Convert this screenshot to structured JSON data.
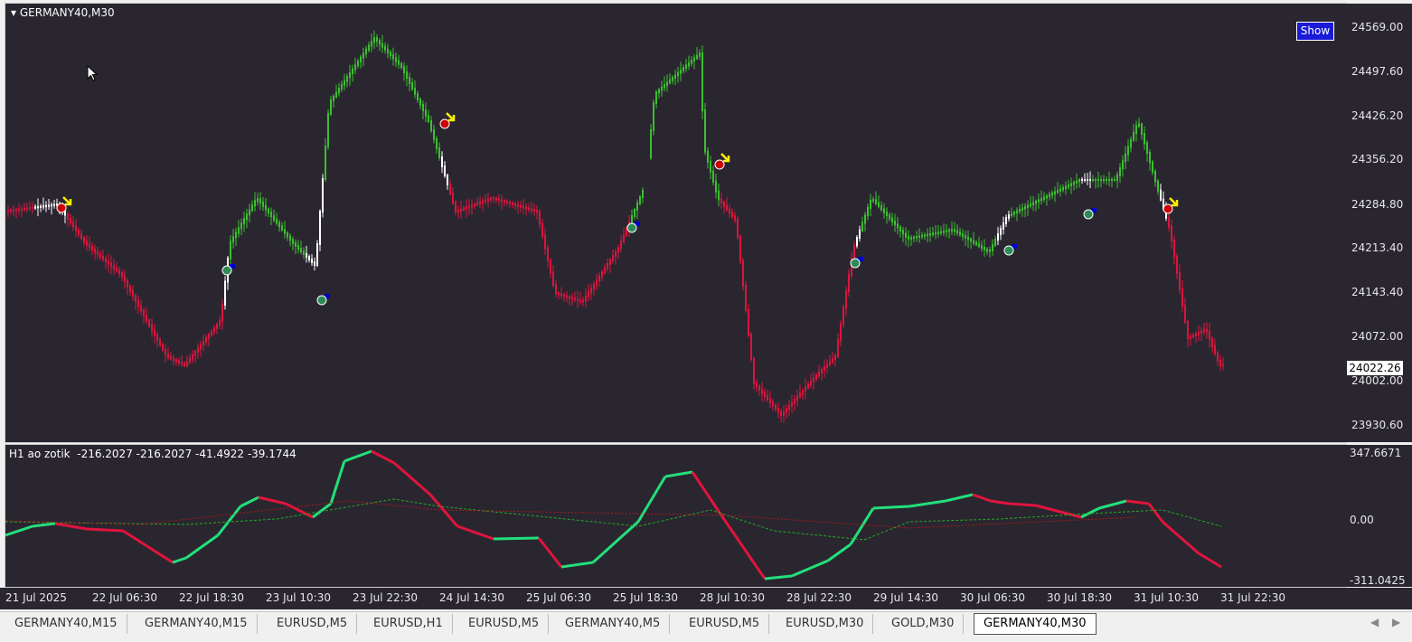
{
  "chart": {
    "symbol_label": "GERMANY40,M30",
    "show_button_label": "Show",
    "current_price": "24022.26",
    "price_axis_labels": [
      "24569.00",
      "24497.60",
      "24426.20",
      "24356.20",
      "24284.80",
      "24213.40",
      "24143.40",
      "24072.00",
      "24002.00",
      "23930.60"
    ],
    "time_axis_labels": [
      "21 Jul 2025",
      "22 Jul 06:30",
      "22 Jul 18:30",
      "23 Jul 10:30",
      "23 Jul 22:30",
      "24 Jul 14:30",
      "25 Jul 06:30",
      "25 Jul 18:30",
      "28 Jul 10:30",
      "28 Jul 22:30",
      "29 Jul 14:30",
      "30 Jul 06:30",
      "30 Jul 18:30",
      "31 Jul 10:30",
      "31 Jul 22:30"
    ],
    "colors": {
      "bull": "#3cbf2f",
      "bear": "#dc143c",
      "neutral": "#ffffff",
      "background": "#2a2630",
      "signal_up": "#0000cc",
      "signal_down": "#ffee00"
    }
  },
  "indicator": {
    "title": "H1 ao zotik  -216.2027 -216.2027 -41.4922 -39.1744",
    "axis_labels": [
      "347.6671",
      "0.00",
      "-311.0425"
    ],
    "colors": {
      "up": "#22e07a",
      "down": "#e0143c",
      "signal_green": "#22aa22",
      "signal_red": "#aa1818"
    }
  },
  "tabs": [
    {
      "label": "GERMANY40,M15",
      "active": false
    },
    {
      "label": "GERMANY40,M15",
      "active": false
    },
    {
      "label": "EURUSD,M5",
      "active": false
    },
    {
      "label": "EURUSD,H1",
      "active": false
    },
    {
      "label": "EURUSD,M5",
      "active": false
    },
    {
      "label": "GERMANY40,M5",
      "active": false
    },
    {
      "label": "EURUSD,M5",
      "active": false
    },
    {
      "label": "EURUSD,M30",
      "active": false
    },
    {
      "label": "GOLD,M30",
      "active": false
    },
    {
      "label": "GERMANY40,M30",
      "active": true
    }
  ],
  "tab_scroll": {
    "left": "◀",
    "right": "▶"
  }
}
